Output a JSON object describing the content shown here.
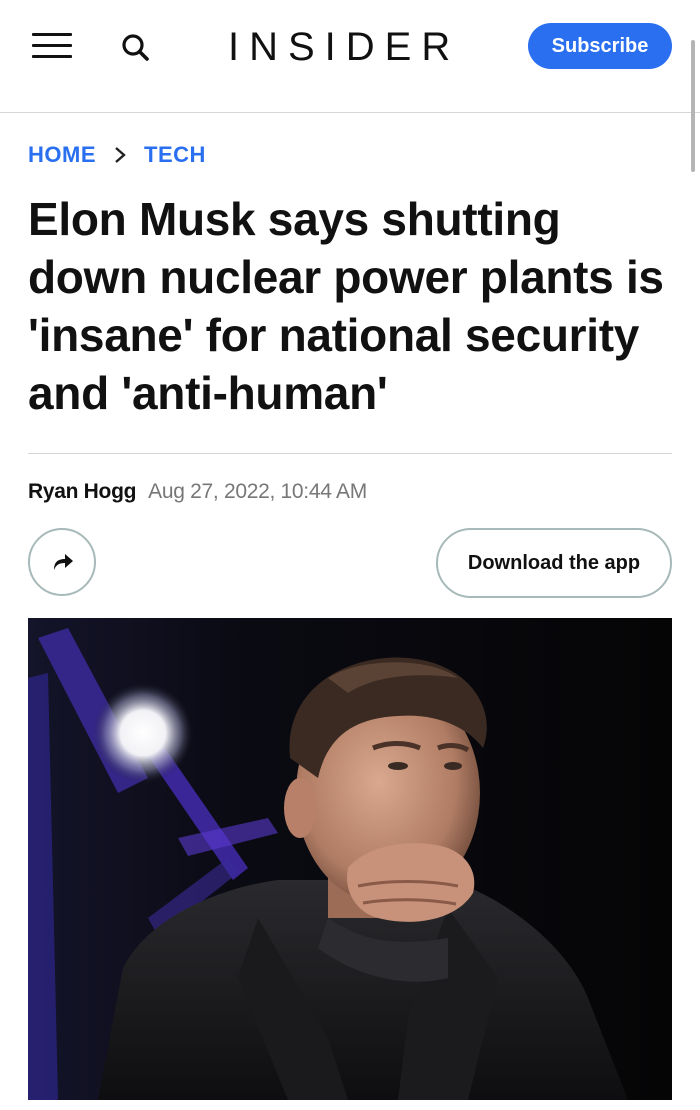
{
  "header": {
    "logo": "INSIDER",
    "subscribe_label": "Subscribe",
    "menu_icon": "hamburger-menu-icon",
    "search_icon": "search-icon",
    "brand_color": "#2a6ff0"
  },
  "breadcrumb": {
    "items": [
      "HOME",
      "TECH"
    ],
    "separator_icon": "chevron-right-icon"
  },
  "article": {
    "title": "Elon Musk says shutting down nuclear power plants is 'insane' for national security and 'anti-human'",
    "author": "Ryan Hogg",
    "date": "Aug 27, 2022, 10:44 AM"
  },
  "actions": {
    "share_icon": "share-arrow-icon",
    "download_label": "Download the app"
  },
  "hero_image": {
    "subject": "photo-of-man-with-hand-on-chin"
  }
}
